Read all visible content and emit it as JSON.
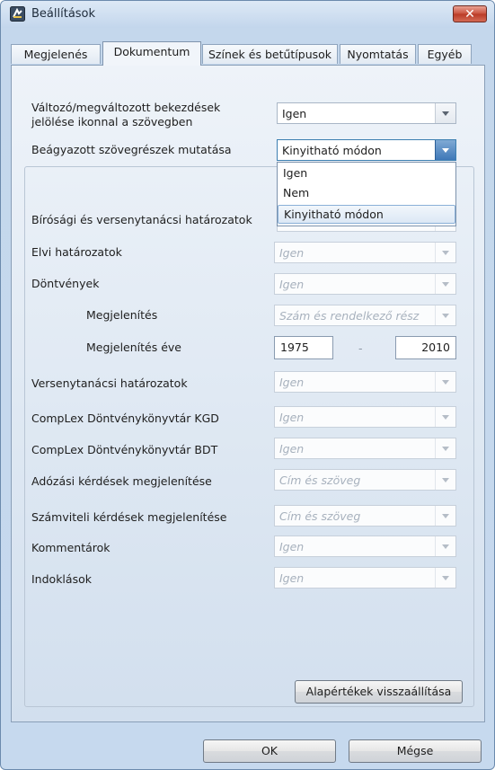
{
  "window": {
    "title": "Beállítások",
    "close_label": "✕"
  },
  "tabs": [
    {
      "label": "Megjelenés",
      "active": false
    },
    {
      "label": "Dokumentum",
      "active": true
    },
    {
      "label": "Színek és betűtípusok",
      "active": false
    },
    {
      "label": "Nyomtatás",
      "active": false
    },
    {
      "label": "Egyéb",
      "active": false
    }
  ],
  "top": {
    "marking_label_line1": "Változó/megváltozott bekezdések",
    "marking_label_line2": "jelölése ikonnal a szövegben",
    "marking_value": "Igen",
    "embedded_label": "Beágyazott szövegrészek mutatása",
    "embedded_value": "Kinyitható módon",
    "dropdown_options": [
      "Igen",
      "Nem",
      "Kinyitható módon"
    ],
    "dropdown_hovered_index": 2
  },
  "settings": [
    {
      "label": "Bírósági és versenytanácsi határozatok",
      "value": ""
    },
    {
      "label": "Elvi határozatok",
      "value": "Igen"
    },
    {
      "label": "Döntvények",
      "value": "Igen"
    },
    {
      "label": "Megjelenítés",
      "value": "Szám és rendelkező rész"
    },
    {
      "label": "Megjelenítés éve",
      "from": "1975",
      "separator": "-",
      "to": "2010"
    },
    {
      "label": "Versenytanácsi határozatok",
      "value": "Igen"
    },
    {
      "label": "CompLex Döntvénykönyvtár KGD",
      "value": "Igen"
    },
    {
      "label": "CompLex Döntvénykönyvtár BDT",
      "value": "Igen"
    },
    {
      "label": "Adózási kérdések megjelenítése",
      "value": "Cím és szöveg"
    },
    {
      "label": "Számviteli kérdések megjelenítése",
      "value": "Cím és szöveg"
    },
    {
      "label": "Kommentárok",
      "value": "Igen"
    },
    {
      "label": "Indoklások",
      "value": "Igen"
    }
  ],
  "buttons": {
    "reset": "Alapértékek visszaállítása",
    "ok": "OK",
    "cancel": "Mégse"
  },
  "colors": {
    "accent": "#3f78b8",
    "close": "#c8503c",
    "disabled_text": "#a7b1bd"
  }
}
